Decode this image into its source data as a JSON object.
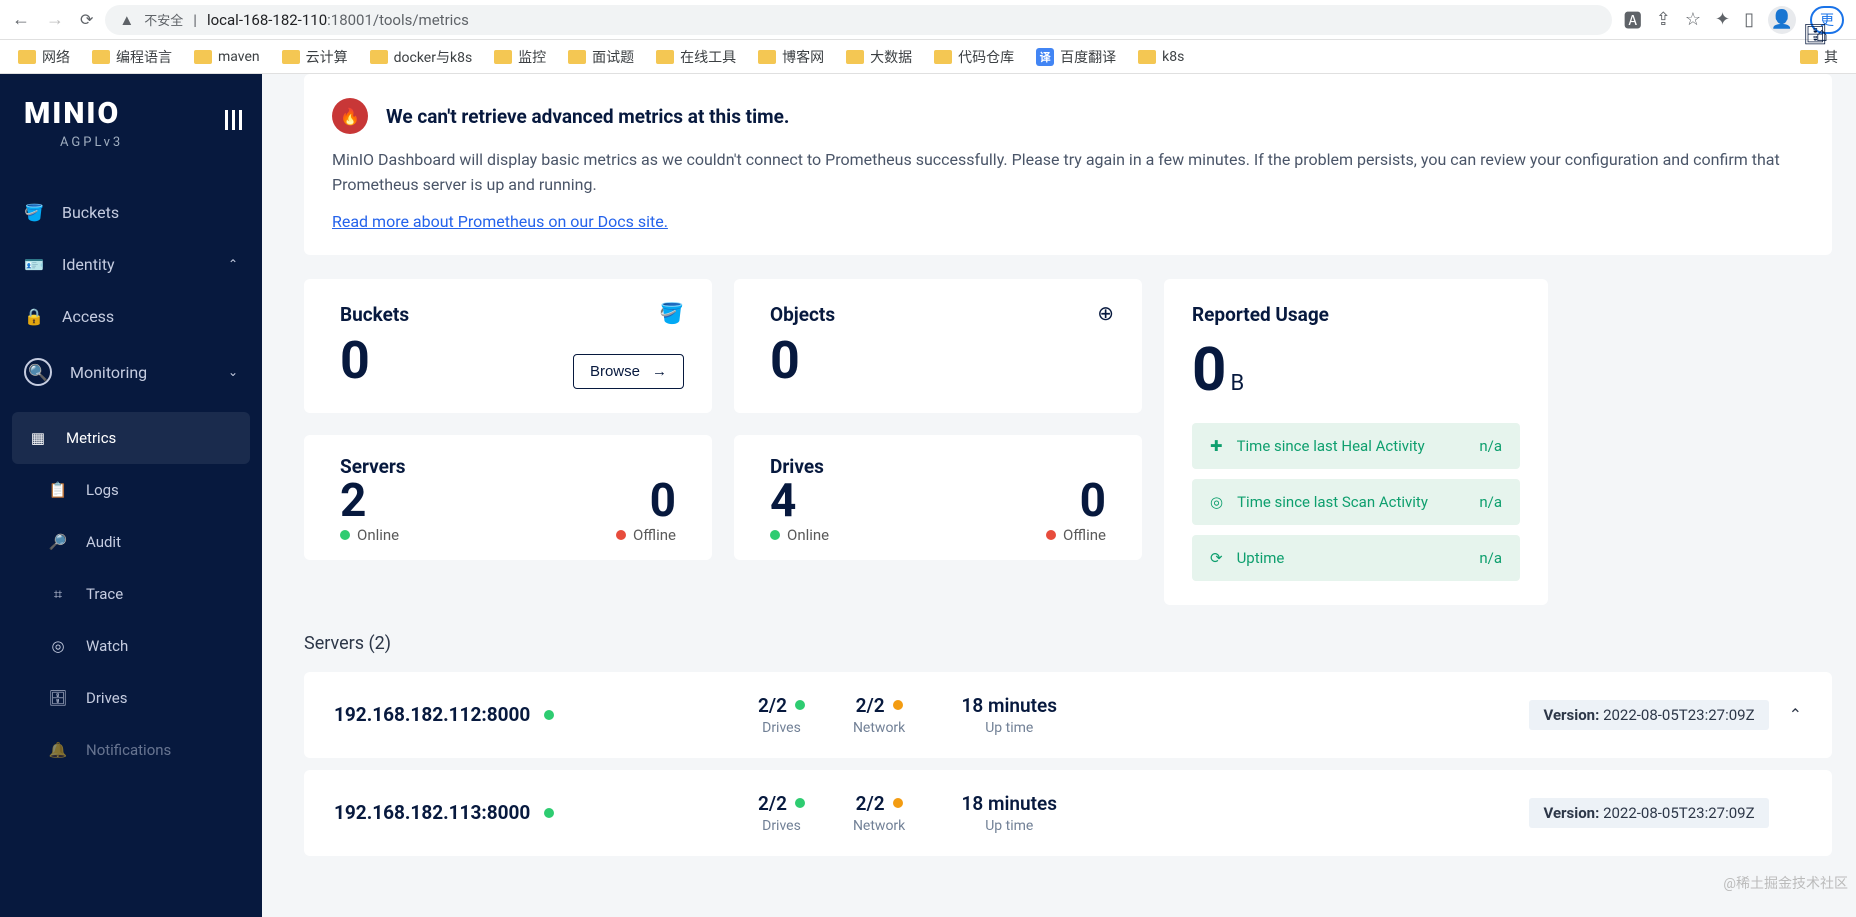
{
  "browser": {
    "url_warning": "不安全",
    "url_host": "local-168-182-110",
    "url_port": ":18001",
    "url_path": "/tools/metrics",
    "update_label": "更"
  },
  "bookmarks": [
    "网络",
    "编程语言",
    "maven",
    "云计算",
    "docker与k8s",
    "监控",
    "面试题",
    "在线工具",
    "博客网",
    "大数据",
    "代码仓库",
    "百度翻译",
    "k8s",
    "其"
  ],
  "sidebar": {
    "logo": "MINIO",
    "license": "AGPLv3",
    "items": [
      {
        "label": "Buckets"
      },
      {
        "label": "Identity"
      },
      {
        "label": "Access"
      },
      {
        "label": "Monitoring"
      }
    ],
    "monitoring_subs": [
      {
        "label": "Metrics"
      },
      {
        "label": "Logs"
      },
      {
        "label": "Audit"
      },
      {
        "label": "Trace"
      },
      {
        "label": "Watch"
      },
      {
        "label": "Drives"
      },
      {
        "label": "Notifications"
      }
    ]
  },
  "alert": {
    "title": "We can't retrieve advanced metrics at this time.",
    "body": "MinIO Dashboard will display basic metrics as we couldn't connect to Prometheus successfully. Please try again in a few minutes. If the problem persists, you can review your configuration and confirm that Prometheus server is up and running.",
    "link": "Read more about Prometheus on our Docs site."
  },
  "stats": {
    "buckets": {
      "label": "Buckets",
      "value": "0",
      "browse": "Browse"
    },
    "objects": {
      "label": "Objects",
      "value": "0"
    },
    "servers": {
      "label": "Servers",
      "online": "2",
      "offline": "0",
      "online_label": "Online",
      "offline_label": "Offline"
    },
    "drives": {
      "label": "Drives",
      "online": "4",
      "offline": "0",
      "online_label": "Online",
      "offline_label": "Offline"
    }
  },
  "reported": {
    "title": "Reported Usage",
    "value": "0",
    "unit": "B",
    "activities": [
      {
        "label": "Time since last Heal Activity",
        "value": "n/a"
      },
      {
        "label": "Time since last Scan Activity",
        "value": "n/a"
      },
      {
        "label": "Uptime",
        "value": "n/a"
      }
    ]
  },
  "servers_section": {
    "title": "Servers (2)",
    "columns": {
      "drives": "Drives",
      "network": "Network",
      "uptime": "Up time"
    },
    "version_label": "Version:",
    "rows": [
      {
        "addr": "192.168.182.112:8000",
        "drives": "2/2",
        "network": "2/2",
        "uptime": "18 minutes",
        "version": "2022-08-05T23:27:09Z"
      },
      {
        "addr": "192.168.182.113:8000",
        "drives": "2/2",
        "network": "2/2",
        "uptime": "18 minutes",
        "version": "2022-08-05T23:27:09Z"
      }
    ]
  },
  "watermark": "@稀土掘金技术社区"
}
